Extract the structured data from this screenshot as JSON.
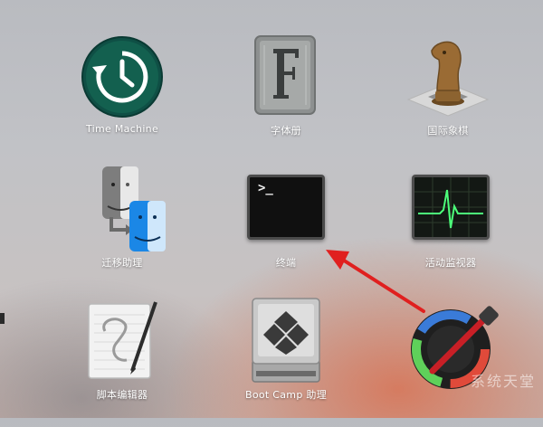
{
  "launchpad": {
    "apps": [
      {
        "label": "Time Machine",
        "icon": "time-machine-icon"
      },
      {
        "label": "字体册",
        "icon": "font-book-icon"
      },
      {
        "label": "国际象棋",
        "icon": "chess-icon"
      },
      {
        "label": "迁移助理",
        "icon": "migration-assistant-icon"
      },
      {
        "label": "终端",
        "icon": "terminal-icon"
      },
      {
        "label": "活动监视器",
        "icon": "activity-monitor-icon"
      },
      {
        "label": "脚本编辑器",
        "icon": "script-editor-icon"
      },
      {
        "label": "Boot Camp 助理",
        "icon": "boot-camp-icon"
      },
      {
        "label": "",
        "icon": "digital-color-meter-icon"
      }
    ],
    "terminal_prompt": ">_"
  },
  "annotation": {
    "arrow_color": "#e0201f",
    "points_to": "终端"
  },
  "watermark": {
    "text": "系统天堂"
  }
}
